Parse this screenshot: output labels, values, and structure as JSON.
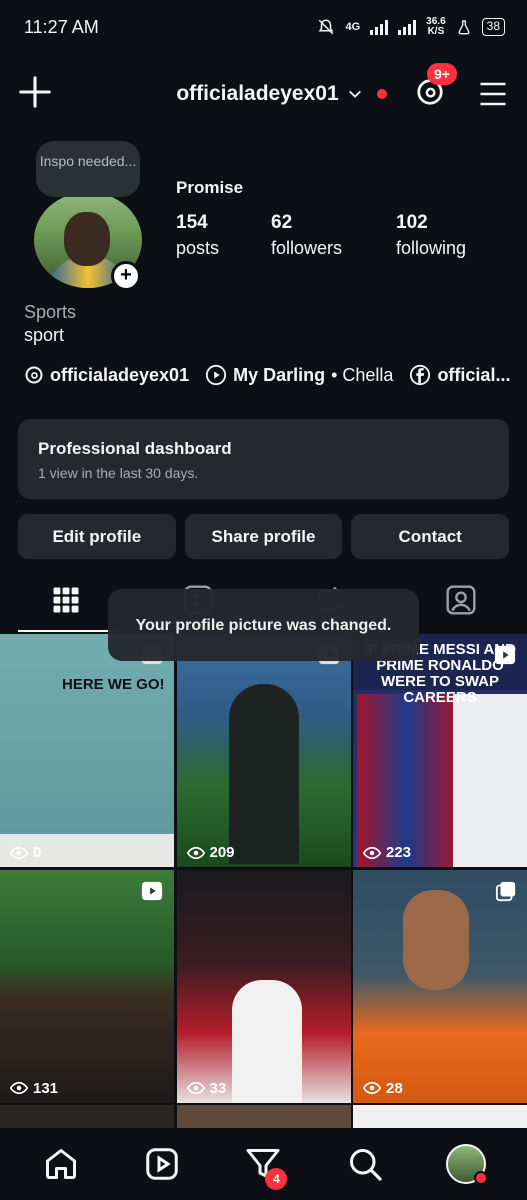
{
  "status_bar": {
    "time": "11:27 AM",
    "network": "4G",
    "speed_value": "36.6",
    "speed_unit": "K/S",
    "battery": "38"
  },
  "header": {
    "username": "officialadeyex01",
    "notification_badge": "9+"
  },
  "profile": {
    "note": "Inspo needed...",
    "display_name": "Promise",
    "stats": [
      {
        "value": "154",
        "label": "posts"
      },
      {
        "value": "62",
        "label": "followers"
      },
      {
        "value": "102",
        "label": "following"
      }
    ],
    "category": "Sports",
    "bio": "sport",
    "threads_link": "officialadeyex01",
    "music_title": "My Darling",
    "music_artist": "• Chella",
    "facebook_link": "official..."
  },
  "dashboard": {
    "title": "Professional dashboard",
    "subtitle": "1 view in the last 30 days."
  },
  "actions": {
    "edit": "Edit profile",
    "share": "Share profile",
    "contact": "Contact"
  },
  "toast": "Your profile picture was changed.",
  "posts": [
    {
      "views": "0",
      "overlay_text": "HERE WE GO!"
    },
    {
      "views": "209"
    },
    {
      "views": "223",
      "overlay_text": "IF PRIME MESSI AND PRIME RONALDO WERE TO SWAP CAREERS"
    },
    {
      "views": "131"
    },
    {
      "views": "33"
    },
    {
      "views": "28"
    }
  ],
  "bottom_nav": {
    "notification_badge": "4"
  },
  "colors": {
    "background": "#0c1014",
    "card": "#25292e",
    "accent": "#ff3040"
  }
}
